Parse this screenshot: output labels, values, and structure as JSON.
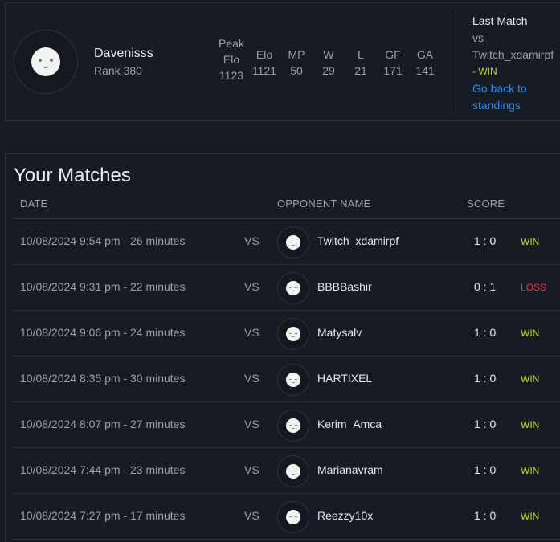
{
  "profile": {
    "username": "Davenisss_",
    "rank": "Rank 380",
    "avatar_icon": "face-avatar-icon",
    "stats": {
      "peak_label_1": "Peak",
      "peak_label_2": "Elo",
      "peak_value": "1123",
      "elo_label": "Elo",
      "elo_value": "1121",
      "mp_label": "MP",
      "mp_value": "50",
      "w_label": "W",
      "w_value": "29",
      "l_label": "L",
      "l_value": "21",
      "gf_label": "GF",
      "gf_value": "171",
      "ga_label": "GA",
      "ga_value": "141"
    }
  },
  "last_match": {
    "title": "Last Match",
    "vs": "vs",
    "opponent": "Twitch_xdamirpf",
    "dash": "-",
    "result": "WIN",
    "link_line1": "Go back to",
    "link_line2": "standings"
  },
  "matches": {
    "title": "Your Matches",
    "headers": {
      "date": "DATE",
      "opponent": "OPPONENT NAME",
      "score": "SCORE"
    },
    "vs_label": "VS",
    "rows": [
      {
        "date": "10/08/2024 9:54 pm - 26 minutes",
        "opponent": "Twitch_xdamirpf",
        "score": "1 : 0",
        "result": "WIN"
      },
      {
        "date": "10/08/2024 9:31 pm - 22 minutes",
        "opponent": "BBBBashir",
        "score": "0 : 1",
        "result": "LOSS"
      },
      {
        "date": "10/08/2024 9:06 pm - 24 minutes",
        "opponent": "Matysalv",
        "score": "1 : 0",
        "result": "WIN"
      },
      {
        "date": "10/08/2024 8:35 pm - 30 minutes",
        "opponent": "HARTIXEL",
        "score": "1 : 0",
        "result": "WIN"
      },
      {
        "date": "10/08/2024 8:07 pm - 27 minutes",
        "opponent": "Kerim_Amca",
        "score": "1 : 0",
        "result": "WIN"
      },
      {
        "date": "10/08/2024 7:44 pm - 23 minutes",
        "opponent": "Marianavram",
        "score": "1 : 0",
        "result": "WIN"
      },
      {
        "date": "10/08/2024 7:27 pm - 17 minutes",
        "opponent": "Reezzy10x",
        "score": "1 : 0",
        "result": "WIN"
      }
    ]
  },
  "colors": {
    "win": "#b7e022",
    "loss": "#f0334a",
    "link": "#2e8cf0",
    "background": "#161a22"
  }
}
